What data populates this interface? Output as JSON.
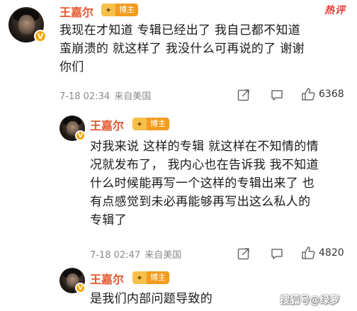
{
  "comments": [
    {
      "username": "王嘉尔",
      "badge_label": "博主",
      "text_lines": [
        "我现在才知道 专辑已经出了 我自己都不知道",
        "蛮崩溃的  就这样了 我没什么可再说的了  谢谢",
        "你们"
      ],
      "time": "7-18 02:34",
      "location": "来自美国",
      "likes": "6368",
      "hot_label": "热评"
    },
    {
      "username": "王嘉尔",
      "badge_label": "博主",
      "text_lines": [
        "对我来说 这样的专辑 就这样在不知情的情",
        "况就发布了，  我内心也在告诉我 我不知道",
        "什么时候能再写一个这样的专辑出来了 也",
        "有点感觉到未必再能够再写出这么私人的",
        "专辑了"
      ],
      "time": "7-18 02:47",
      "location": "来自美国",
      "likes": "4820"
    },
    {
      "username": "王嘉尔",
      "badge_label": "博主",
      "text_lines": [
        "是我们内部问题导致的"
      ]
    }
  ],
  "watermark": "搜狐号@绿萝",
  "colors": {
    "username": "#e4572e",
    "hot_label": "#e53935",
    "badge": "#f39c1f",
    "verified": "#f6a500"
  },
  "icons": [
    "verified-badge-icon",
    "share-icon",
    "reply-icon",
    "like-icon"
  ]
}
